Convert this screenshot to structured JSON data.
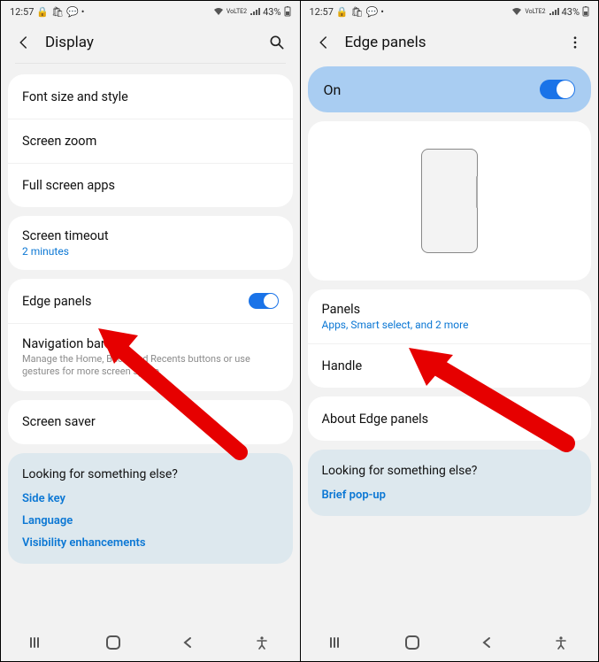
{
  "status": {
    "time": "12:57",
    "battery": "43%",
    "net": "VoLTE2"
  },
  "left": {
    "header": {
      "title": "Display"
    },
    "rows": {
      "font": "Font size and style",
      "zoom": "Screen zoom",
      "fullscreen": "Full screen apps",
      "timeout": {
        "label": "Screen timeout",
        "sub": "2 minutes"
      },
      "edge": "Edge panels",
      "nav": {
        "label": "Navigation bar",
        "sub": "Manage the Home, Back, and Recents buttons or use gestures for more screen space."
      },
      "saver": "Screen saver"
    },
    "looking": {
      "title": "Looking for something else?",
      "links": [
        "Side key",
        "Language",
        "Visibility enhancements"
      ]
    }
  },
  "right": {
    "header": {
      "title": "Edge panels"
    },
    "master": "On",
    "rows": {
      "panels": {
        "label": "Panels",
        "sub": "Apps, Smart select, and 2 more"
      },
      "handle": "Handle",
      "about": "About Edge panels"
    },
    "looking": {
      "title": "Looking for something else?",
      "links": [
        "Brief pop-up"
      ]
    }
  }
}
